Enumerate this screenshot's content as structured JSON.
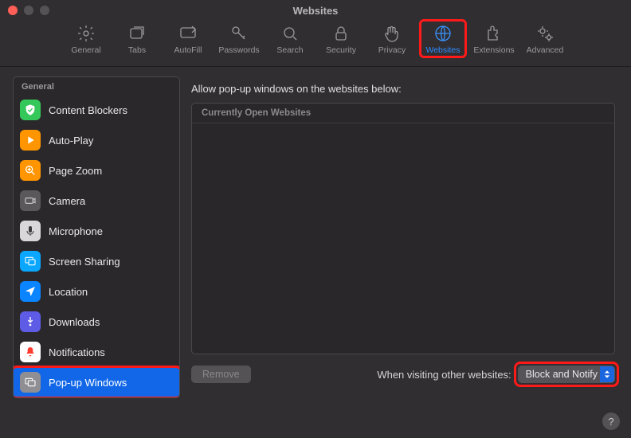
{
  "window": {
    "title": "Websites"
  },
  "toolbar": {
    "items": [
      {
        "id": "general",
        "label": "General"
      },
      {
        "id": "tabs",
        "label": "Tabs"
      },
      {
        "id": "autofill",
        "label": "AutoFill"
      },
      {
        "id": "passwords",
        "label": "Passwords"
      },
      {
        "id": "search",
        "label": "Search"
      },
      {
        "id": "security",
        "label": "Security"
      },
      {
        "id": "privacy",
        "label": "Privacy"
      },
      {
        "id": "websites",
        "label": "Websites"
      },
      {
        "id": "extensions",
        "label": "Extensions"
      },
      {
        "id": "advanced",
        "label": "Advanced"
      }
    ],
    "active_id": "websites"
  },
  "sidebar": {
    "header": "General",
    "items": [
      {
        "id": "content-blockers",
        "label": "Content Blockers",
        "icon": "shield",
        "bg": "#34c759"
      },
      {
        "id": "auto-play",
        "label": "Auto-Play",
        "icon": "play",
        "bg": "#ff9500"
      },
      {
        "id": "page-zoom",
        "label": "Page Zoom",
        "icon": "zoom",
        "bg": "#ff9500"
      },
      {
        "id": "camera",
        "label": "Camera",
        "icon": "camera",
        "bg": "#5a585b"
      },
      {
        "id": "microphone",
        "label": "Microphone",
        "icon": "mic",
        "bg": "#d9d7da"
      },
      {
        "id": "screen-sharing",
        "label": "Screen Sharing",
        "icon": "screen",
        "bg": "#0a84ff"
      },
      {
        "id": "location",
        "label": "Location",
        "icon": "location",
        "bg": "#0a84ff"
      },
      {
        "id": "downloads",
        "label": "Downloads",
        "icon": "download",
        "bg": "#5e5ce6"
      },
      {
        "id": "notifications",
        "label": "Notifications",
        "icon": "bell",
        "bg": "#ffffff"
      },
      {
        "id": "popups",
        "label": "Pop-up Windows",
        "icon": "windows",
        "bg": "#8e8e93"
      }
    ],
    "selected_id": "popups"
  },
  "detail": {
    "heading": "Allow pop-up windows on the websites below:",
    "list_header": "Currently Open Websites",
    "remove_label": "Remove",
    "remove_enabled": false,
    "footer_label": "When visiting other websites:",
    "select_value": "Block and Notify"
  },
  "help_glyph": "?",
  "colors": {
    "accent": "#1167e7",
    "highlight": "#ff1a1a"
  }
}
